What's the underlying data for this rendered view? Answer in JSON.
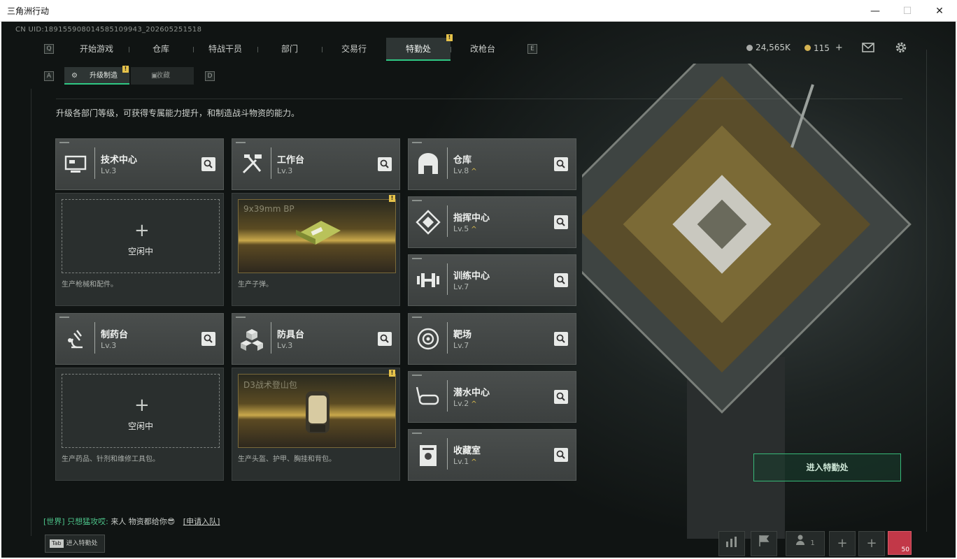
{
  "window": {
    "title": "三角洲行动",
    "min": "—",
    "max": "☐",
    "close": "✕"
  },
  "uid": "CN UID:1891559080145851099​43_202605251518",
  "keys": {
    "left_main": "Q",
    "right_main": "E",
    "left_sub": "A",
    "right_sub": "D"
  },
  "nav": {
    "tabs": [
      "开始游戏",
      "仓库",
      "特战干员",
      "部门",
      "交易行",
      "特勤处",
      "改枪台"
    ],
    "active": "特勤处",
    "alert": "!"
  },
  "subnav": {
    "tabs": [
      "升级制造",
      "收藏"
    ],
    "active": "升级制造",
    "alert": "!"
  },
  "currency": {
    "coins": "24,565K",
    "tickets": "115",
    "plus": "+"
  },
  "description": "升级各部门等级，可获得专属能力提升，和制造战斗物资的能力。",
  "departments": [
    {
      "name": "技术中心",
      "level": "Lv.3",
      "icon": "computer-icon"
    },
    {
      "name": "工作台",
      "level": "Lv.3",
      "icon": "tools-icon"
    },
    {
      "name": "仓库",
      "level": "Lv.8",
      "icon": "warehouse-icon",
      "upgrade": "^"
    },
    {
      "name": "指挥中心",
      "level": "Lv.5",
      "icon": "command-icon",
      "upgrade": "^"
    },
    {
      "name": "训练中心",
      "level": "Lv.7",
      "icon": "dumbbell-icon"
    },
    {
      "name": "制药台",
      "level": "Lv.3",
      "icon": "microscope-icon"
    },
    {
      "name": "防具台",
      "level": "Lv.3",
      "icon": "cubes-icon"
    },
    {
      "name": "靶场",
      "level": "Lv.7",
      "icon": "target-icon"
    },
    {
      "name": "潜水中心",
      "level": "Lv.2",
      "icon": "diving-mask-icon",
      "upgrade": "^"
    },
    {
      "name": "收藏室",
      "level": "Lv.1",
      "icon": "collection-icon",
      "upgrade": "^"
    }
  ],
  "production": [
    {
      "status": "空闲中",
      "plus": "+",
      "desc": "生产枪械和配件。"
    },
    {
      "item": "9x39mm BP",
      "desc": "生产子弹。",
      "alert": "!"
    },
    {
      "status": "空闲中",
      "plus": "+",
      "desc": "生产药品、针剂和维修工具包。"
    },
    {
      "item": "D3战术登山包",
      "desc": "生产头盔、护甲、胸挂和背包。",
      "alert": "!"
    }
  ],
  "enter_button": "进入特勤处",
  "chat": {
    "channel": "[世界]",
    "sender": "只想猛攻哎:",
    "message": "来人 物资都给你😎",
    "action": "[申请入队]"
  },
  "tab_hint": {
    "key": "Tab",
    "label": "进入特勤处"
  },
  "bottom": {
    "party_count": "1",
    "avatar_level": "50"
  },
  "colors": {
    "accent": "#2fc783",
    "upgrade": "#e0c14d",
    "alert": "#e5c24a"
  }
}
